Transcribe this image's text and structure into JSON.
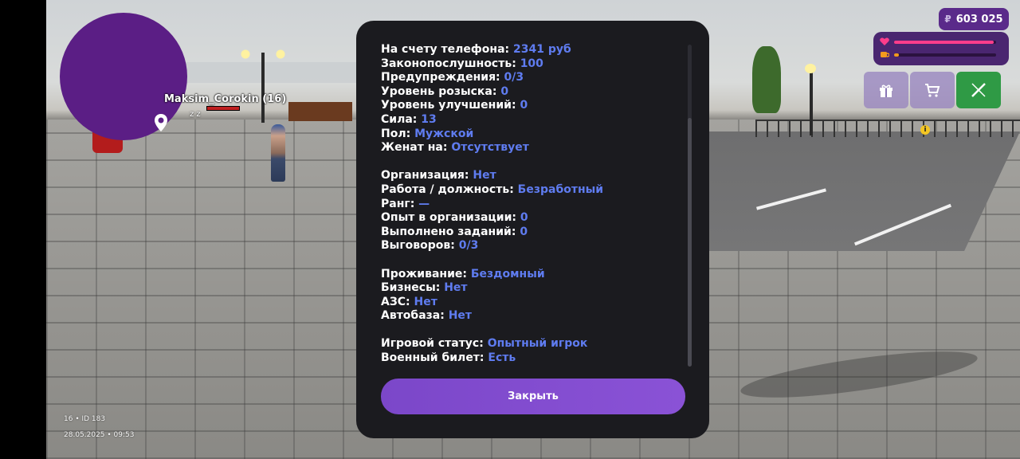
{
  "player": {
    "nametag": "Maksim_Corokin (16)",
    "status_glyph": "z z"
  },
  "minimap": {
    "pin_icon": "map-pin-icon"
  },
  "hud": {
    "currency_symbol": "₽",
    "money": "603 025",
    "health_fraction": 0.98,
    "hunger_fraction": 0.05,
    "buttons": [
      {
        "icon": "gift-icon"
      },
      {
        "icon": "cart-icon"
      },
      {
        "icon": "weapon-icon"
      }
    ],
    "info_badge": "i"
  },
  "bottom_info": {
    "line1": "16 • ID 183",
    "line2": "28.05.2025 • 09:53"
  },
  "stats": {
    "groups": [
      [
        {
          "label": "На счету телефона:",
          "value": "2341 руб"
        },
        {
          "label": "Законопослушность:",
          "value": "100"
        },
        {
          "label": "Предупреждения:",
          "value": "0/3"
        },
        {
          "label": "Уровень розыска:",
          "value": "0"
        },
        {
          "label": "Уровень улучшений:",
          "value": "0"
        },
        {
          "label": "Сила:",
          "value": "13"
        },
        {
          "label": "Пол:",
          "value": "Мужской"
        },
        {
          "label": "Женат на:",
          "value": "Отсутствует"
        }
      ],
      [
        {
          "label": "Организация:",
          "value": "Нет"
        },
        {
          "label": "Работа / должность:",
          "value": "Безработный"
        },
        {
          "label": "Ранг:",
          "value": "—"
        },
        {
          "label": "Опыт в организации:",
          "value": "0"
        },
        {
          "label": "Выполнено заданий:",
          "value": "0"
        },
        {
          "label": "Выговоров:",
          "value": "0/3"
        }
      ],
      [
        {
          "label": "Проживание:",
          "value": "Бездомный"
        },
        {
          "label": "Бизнесы:",
          "value": "Нет"
        },
        {
          "label": "АЗС:",
          "value": "Нет"
        },
        {
          "label": "Автобаза:",
          "value": "Нет"
        }
      ],
      [
        {
          "label": "Игровой статус:",
          "value": "Опытный игрок"
        },
        {
          "label": "Военный билет:",
          "value": "Есть"
        }
      ]
    ],
    "close_label": "Закрыть"
  },
  "colors": {
    "accent": "#5f7cf0",
    "button": "#8a52d6",
    "dialog_bg": "#1b1b1f",
    "hud_purple": "#5a2a8a",
    "health": "#ff3d8b",
    "hunger": "#f39a1d"
  }
}
